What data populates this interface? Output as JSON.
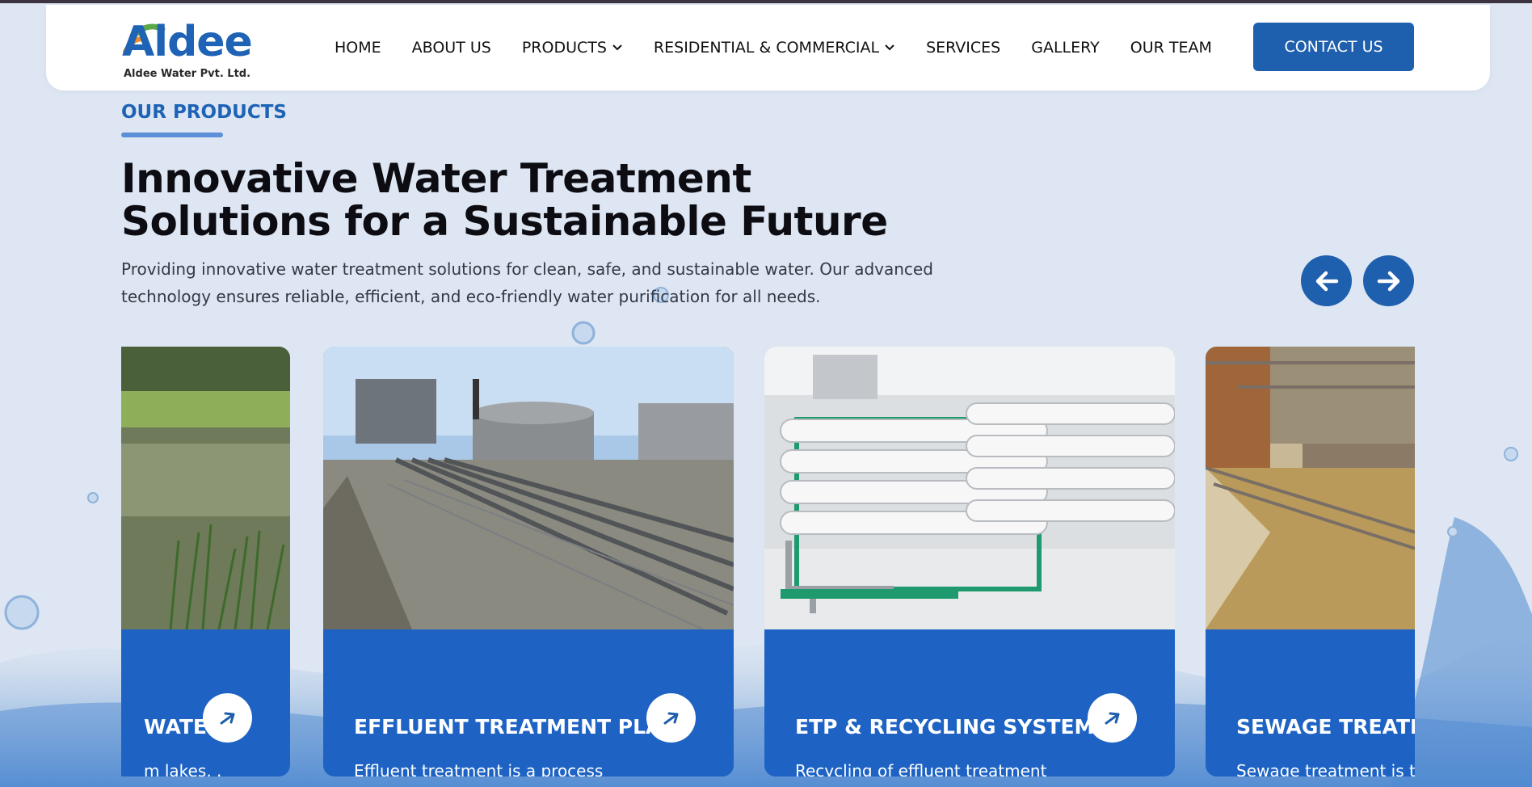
{
  "brand": {
    "logo_text": "Aldee",
    "company_name": "Aldee Water Pvt. Ltd.",
    "primary_color": "#1e5fae",
    "accent_green": "#5aa846",
    "accent_orange": "#f08a24"
  },
  "nav": {
    "items": [
      {
        "label": "HOME",
        "dropdown": false
      },
      {
        "label": "ABOUT US",
        "dropdown": false
      },
      {
        "label": "PRODUCTS",
        "dropdown": true
      },
      {
        "label": "RESIDENTIAL & COMMERCIAL",
        "dropdown": true
      },
      {
        "label": "SERVICES",
        "dropdown": false
      },
      {
        "label": "GALLERY",
        "dropdown": false
      },
      {
        "label": "OUR TEAM",
        "dropdown": false
      }
    ],
    "contact_label": "CONTACT US"
  },
  "section": {
    "eyebrow": "OUR PRODUCTS",
    "headline": "Innovative Water Treatment Solutions for a Sustainable Future",
    "lead": "Providing innovative water treatment solutions for clean, safe, and sustainable water. Our advanced technology ensures reliable, efficient, and eco-friendly water purification for all needs."
  },
  "carousel": {
    "prev_icon": "arrow-left-icon",
    "next_icon": "arrow-right-icon",
    "cards": [
      {
        "title": "WATER",
        "desc": "m lakes, .",
        "image": "lake-reeds"
      },
      {
        "title": "EFFLUENT TREATMENT PLANT",
        "desc": "Effluent treatment is a process of treating the waste water...",
        "image": "effluent-plant"
      },
      {
        "title": "ETP & RECYCLING SYSTEM",
        "desc": "Recycling of effluent treatment is very important due to...",
        "image": "ro-membrane-skid"
      },
      {
        "title": "SEWAGE TREATM",
        "desc": "Sewage treatment is the removing contamination",
        "image": "sewage-tank"
      }
    ]
  }
}
